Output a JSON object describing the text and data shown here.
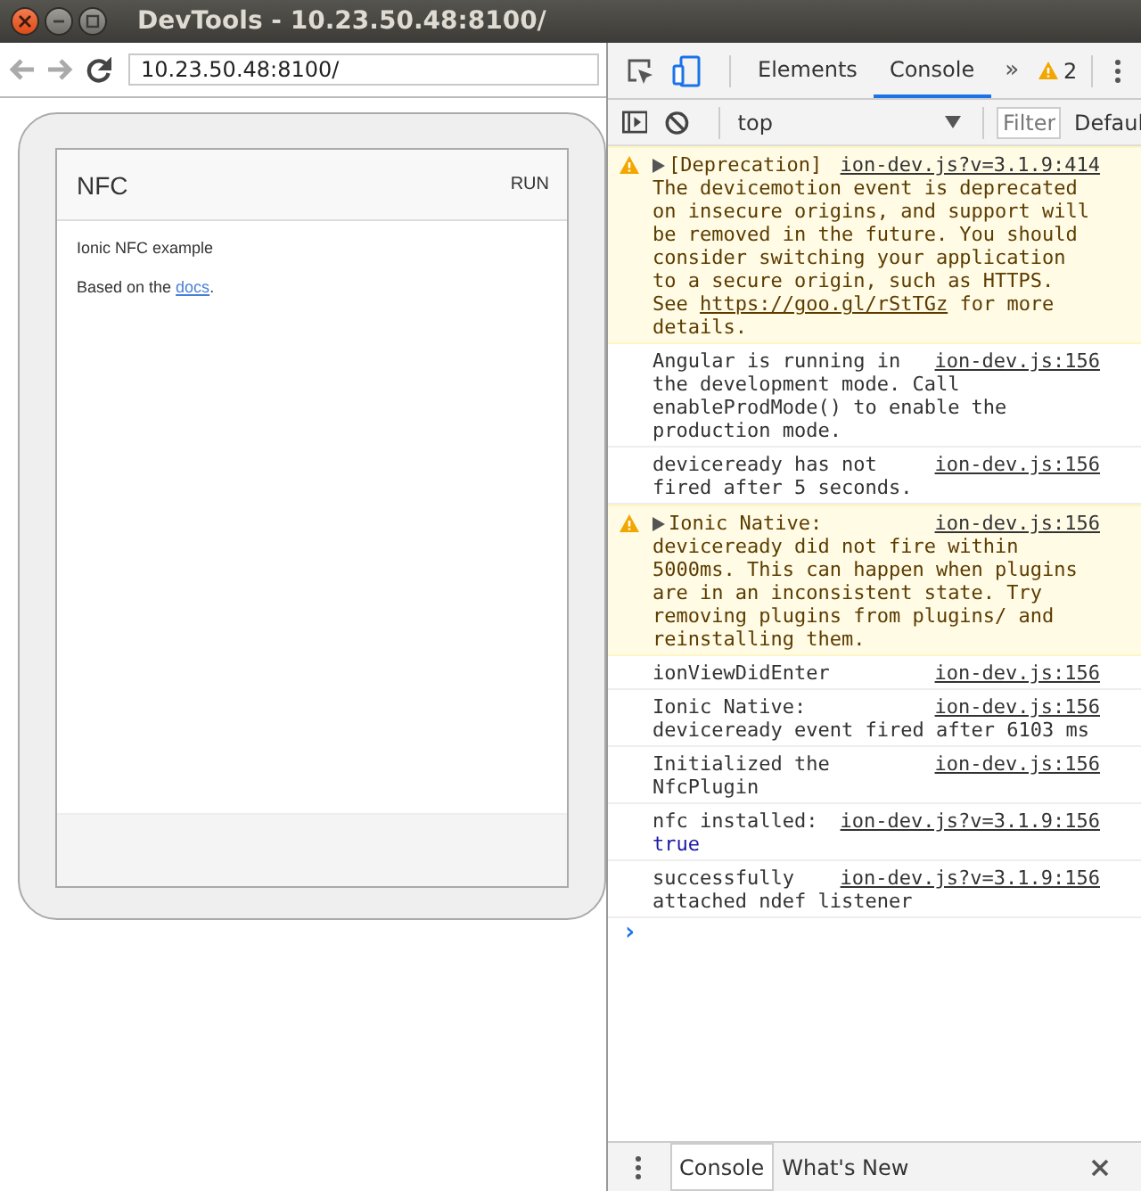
{
  "window": {
    "title": "DevTools - 10.23.50.48:8100/"
  },
  "browser": {
    "back_disabled": true,
    "forward_disabled": true,
    "url": "10.23.50.48:8100/"
  },
  "app": {
    "title": "NFC",
    "action": "RUN",
    "paragraphs": [
      {
        "text": "Ionic NFC example"
      },
      {
        "text": "Based on the ",
        "link": "docs",
        "after": "."
      }
    ]
  },
  "devtools": {
    "tabs": [
      {
        "label": "Elements",
        "selected": false
      },
      {
        "label": "Console",
        "selected": true
      }
    ],
    "more": "»",
    "warning_count": "2",
    "context": "top",
    "filter": {
      "placeholder": "Filter"
    },
    "levels": "Defaul",
    "messages": [
      {
        "kind": "warning",
        "expandable": true,
        "text": "[Deprecation]",
        "source": "ion-dev.js?v=3.1.9:414",
        "body": [
          {
            "kind": "text",
            "text": "The devicemotion event is deprecated on insecure origins, and support will be removed in the future. You should consider switching your application to a secure origin, such as HTTPS. See "
          },
          {
            "kind": "link",
            "text": "https://goo.gl/rStTGz"
          },
          {
            "kind": "text",
            "text": " for more details."
          }
        ]
      },
      {
        "kind": "info",
        "expandable": false,
        "text": "Angular is running in",
        "source": "ion-dev.js:156",
        "body": [
          {
            "kind": "text",
            "text": "the development mode. Call enableProdMode() to enable the production mode."
          }
        ]
      },
      {
        "kind": "info",
        "expandable": false,
        "text": "deviceready has not",
        "source": "ion-dev.js:156",
        "body": [
          {
            "kind": "text",
            "text": "fired after 5 seconds."
          }
        ]
      },
      {
        "kind": "warning",
        "expandable": true,
        "text": "Ionic Native:",
        "source": "ion-dev.js:156",
        "body": [
          {
            "kind": "text",
            "text": "deviceready did not fire within 5000ms. This can happen when plugins are in an inconsistent state. Try removing plugins from plugins/ and reinstalling them."
          }
        ]
      },
      {
        "kind": "info",
        "expandable": false,
        "text": "ionViewDidEnter",
        "source": "ion-dev.js:156"
      },
      {
        "kind": "info",
        "expandable": false,
        "text": "Ionic Native:",
        "source": "ion-dev.js:156",
        "body": [
          {
            "kind": "text",
            "text": "deviceready event fired after 6103 ms"
          }
        ]
      },
      {
        "kind": "info",
        "expandable": false,
        "text": "Initialized the",
        "source": "ion-dev.js:156",
        "body": [
          {
            "kind": "text",
            "text": "NfcPlugin"
          }
        ]
      },
      {
        "kind": "info",
        "expandable": false,
        "text": "nfc installed:",
        "source": "ion-dev.js?v=3.1.9:156",
        "value": "true"
      },
      {
        "kind": "info",
        "expandable": false,
        "text": "successfully",
        "source": "ion-dev.js?v=3.1.9:156",
        "body": [
          {
            "kind": "text",
            "text": "attached ndef listener"
          }
        ]
      }
    ],
    "prompt": "›",
    "drawer_tabs": [
      {
        "label": "Console",
        "selected": true
      },
      {
        "label": "What's New",
        "selected": false
      }
    ]
  }
}
